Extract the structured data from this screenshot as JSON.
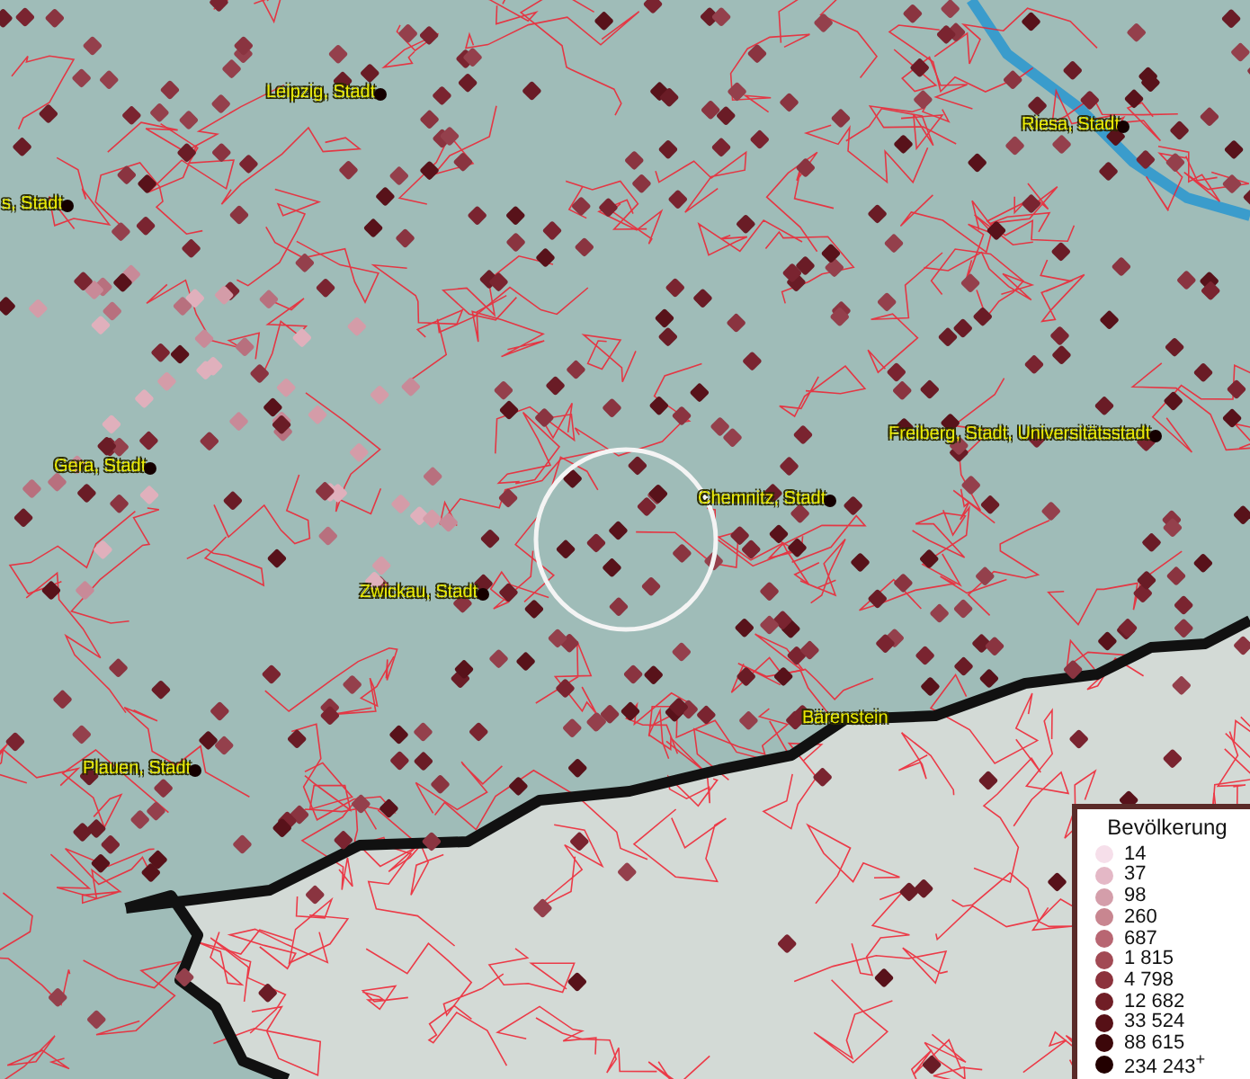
{
  "map": {
    "cities": [
      {
        "label": "Leipzig, Stadt"
      },
      {
        "label": "Riesa, Stadt"
      },
      {
        "label": "s, Stadt"
      },
      {
        "label": "Freiberg, Stadt, Universitätsstadt"
      },
      {
        "label": "Gera, Stadt"
      },
      {
        "label": "Chemnitz, Stadt"
      },
      {
        "label": "Zwickau, Stadt"
      },
      {
        "label": "Plauen, Stadt"
      },
      {
        "label": "Bärenstein"
      }
    ]
  },
  "legend": {
    "title": "Bevölkerung",
    "items": [
      {
        "label": "14",
        "color": "#f6dfea"
      },
      {
        "label": "37",
        "color": "#e4b8c6"
      },
      {
        "label": "98",
        "color": "#d49eaa"
      },
      {
        "label": "260",
        "color": "#c88690"
      },
      {
        "label": "687",
        "color": "#b86672"
      },
      {
        "label": "1 815",
        "color": "#a24a54"
      },
      {
        "label": "4 798",
        "color": "#8c323c"
      },
      {
        "label": "12 682",
        "color": "#701e26"
      },
      {
        "label": "33 524",
        "color": "#561016"
      },
      {
        "label": "88 615",
        "color": "#3c070a"
      },
      {
        "label": "234 243$^{+}$",
        "color": "#220000"
      }
    ]
  }
}
